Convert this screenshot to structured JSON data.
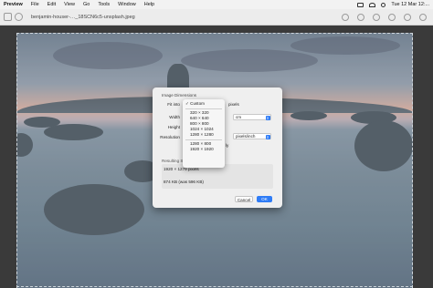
{
  "menubar": {
    "app": "Preview",
    "items": [
      "File",
      "Edit",
      "View",
      "Go",
      "Tools",
      "Window",
      "Help"
    ],
    "clock": "Tue 12 Mar 12:..."
  },
  "toolbar": {
    "filename": "benjamin-houser-…_18SCN6c5-unsplash.jpeg"
  },
  "dialog": {
    "title": "Image Dimensions",
    "fit_into_label": "Fit into",
    "fit_into_unit": "pixels",
    "width_label": "Width",
    "height_label": "Height",
    "resolution_label": "Resolution",
    "cm_value": "cm",
    "resolution_unit": "pixels/inch",
    "resample_label": "ly",
    "resulting_size_label": "Resulting Size",
    "resulting_pixels": "1920 × 1279 pixels",
    "resulting_kb": "874 KB (was 596 KB)",
    "cancel_label": "Cancel",
    "ok_label": "OK"
  },
  "popup": {
    "options": [
      "✓ Custom",
      "320 × 320",
      "640 × 640",
      "800 × 800",
      "1024 × 1024",
      "1280 × 1280",
      "1280 × 800",
      "1920 × 1920"
    ]
  },
  "colors": {
    "accent": "#2f7cf6"
  }
}
